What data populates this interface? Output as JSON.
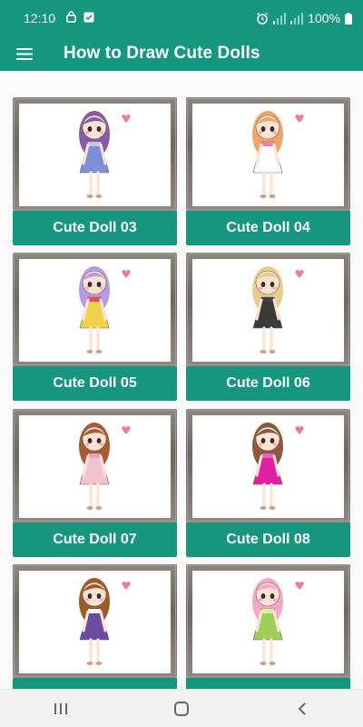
{
  "status_bar": {
    "time": "12:10",
    "battery": "100%",
    "icons": [
      "lock-icon",
      "download-icon",
      "alarm-icon",
      "signal-icon",
      "signal-icon",
      "battery-icon"
    ]
  },
  "app_bar": {
    "title": "How to Draw Cute Dolls",
    "menu_icon": "hamburger-menu-icon",
    "color": "#16967f"
  },
  "dolls": [
    {
      "label": "Cute Doll 03",
      "hair": "#8a5aa6",
      "dress": "#7d8fd6",
      "accent": "#c0c8ec"
    },
    {
      "label": "Cute Doll 04",
      "hair": "#f0a36a",
      "dress": "#ffffff",
      "accent": "#f27fa0"
    },
    {
      "label": "Cute Doll 05",
      "hair": "#b69ae6",
      "dress": "#f2d24c",
      "accent": "#e8505b"
    },
    {
      "label": "Cute Doll 06",
      "hair": "#e9cc8c",
      "dress": "#3a3a3a",
      "accent": "#444444"
    },
    {
      "label": "Cute Doll 07",
      "hair": "#a85a32",
      "dress": "#f3c3d0",
      "accent": "#e9a0b4"
    },
    {
      "label": "Cute Doll 08",
      "hair": "#8a5a3a",
      "dress": "#e020a0",
      "accent": "#f060c0"
    },
    {
      "label": "",
      "hair": "#9a5a2a",
      "dress": "#6b4aa0",
      "accent": "#ffffff"
    },
    {
      "label": "",
      "hair": "#f5a7c8",
      "dress": "#9fcf5a",
      "accent": "#d8f09a"
    }
  ],
  "nav_bar": {
    "recent_icon": "recent-apps-icon",
    "home_icon": "home-icon",
    "back_icon": "back-icon"
  }
}
